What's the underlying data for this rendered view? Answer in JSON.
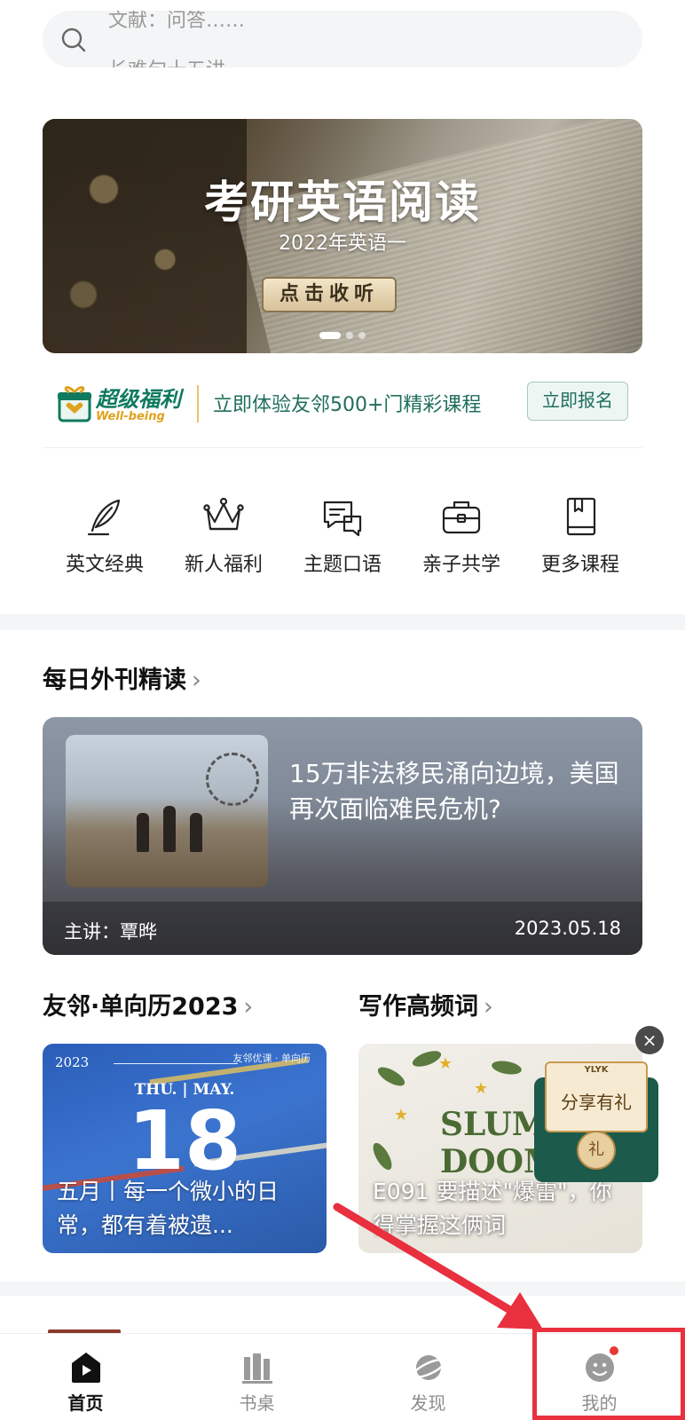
{
  "search": {
    "rolling_prev": "文献：问答……",
    "rolling_current": "长难句十五讲"
  },
  "banner": {
    "title": "考研英语阅读",
    "subtitle": "2022年英语一",
    "button": "点击收听"
  },
  "welfare": {
    "logo_title": "超级福利",
    "logo_sub": "Well-being",
    "text": "立即体验友邻500+门精彩课程",
    "button": "立即报名"
  },
  "quick_links": [
    {
      "label": "英文经典",
      "icon": "quill-icon"
    },
    {
      "label": "新人福利",
      "icon": "crown-icon"
    },
    {
      "label": "主题口语",
      "icon": "chat-bubbles-icon"
    },
    {
      "label": "亲子共学",
      "icon": "briefcase-icon"
    },
    {
      "label": "更多课程",
      "icon": "book-icon"
    }
  ],
  "daily": {
    "section_title": "每日外刊精读",
    "chevron": "›",
    "article_title": "15万非法移民涌向边境，美国再次面临难民危机?",
    "speaker": "主讲：覃晔",
    "date": "2023.05.18"
  },
  "calendar": {
    "section_title": "友邻·单向历2023",
    "year": "2023",
    "brand": "友邻优课 · 单向历",
    "weekday": "THU. | MAY.",
    "day": "18",
    "caption": "五月丨每一个微小的日常，都有着被遗..."
  },
  "writing": {
    "section_title": "写作高频词",
    "cover_word": "SLUM DOOM",
    "caption": "E091 要描述\"爆雷\"，你得掌握这俩词"
  },
  "share_float": {
    "tag": "YLYK",
    "text": "分享有礼",
    "seal": "礼",
    "close": "×"
  },
  "tabbar": [
    {
      "label": "首页",
      "icon": "home-play-icon",
      "active": true
    },
    {
      "label": "书桌",
      "icon": "bookshelf-icon",
      "active": false
    },
    {
      "label": "发现",
      "icon": "planet-icon",
      "active": false
    },
    {
      "label": "我的",
      "icon": "profile-icon",
      "active": false
    }
  ],
  "colors": {
    "accent_green": "#1f6e5b",
    "annotation_red": "#e8303f",
    "badge_red": "#e53935"
  }
}
